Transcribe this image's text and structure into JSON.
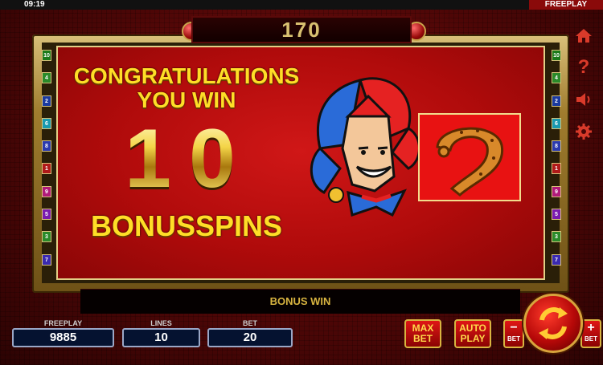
{
  "status": {
    "time": "09:19",
    "mode": "FREEPLAY"
  },
  "counter": "170",
  "win": {
    "line1": "CONGRATULATIONS",
    "line2": "YOU WIN",
    "amount": "10",
    "label": "BONUSSPINS"
  },
  "bonus_bar": "BONUS WIN",
  "lines_left": [
    "10",
    "4",
    "2",
    "6",
    "8",
    "1",
    "9",
    "5",
    "3",
    "7"
  ],
  "lines_right": [
    "10",
    "4",
    "2",
    "6",
    "8",
    "1",
    "9",
    "5",
    "3",
    "7"
  ],
  "line_colors": [
    "#1a7a1a",
    "#2a8a2a",
    "#1a3aa0",
    "#1a9ab0",
    "#2a3ab0",
    "#b01a1a",
    "#b01a7a",
    "#7a1ab0",
    "#2a8a2a",
    "#3a2ab0"
  ],
  "info": {
    "freeplay_label": "FREEPLAY",
    "freeplay_value": "9885",
    "lines_label": "LINES",
    "lines_value": "10",
    "bet_label": "BET",
    "bet_value": "20"
  },
  "buttons": {
    "max_bet_l1": "MAX",
    "max_bet_l2": "BET",
    "auto_play_l1": "AUTO",
    "auto_play_l2": "PLAY",
    "bet_minus_sym": "−",
    "bet_minus_label": "BET",
    "bet_plus_sym": "+",
    "bet_plus_label": "BET"
  },
  "side_menu_icons": [
    "home-icon",
    "help-icon",
    "sound-icon",
    "settings-icon"
  ],
  "colors": {
    "accent_gold": "#ffde27",
    "panel_red": "#c30f0f",
    "frame_gold": "#d9c07a"
  }
}
